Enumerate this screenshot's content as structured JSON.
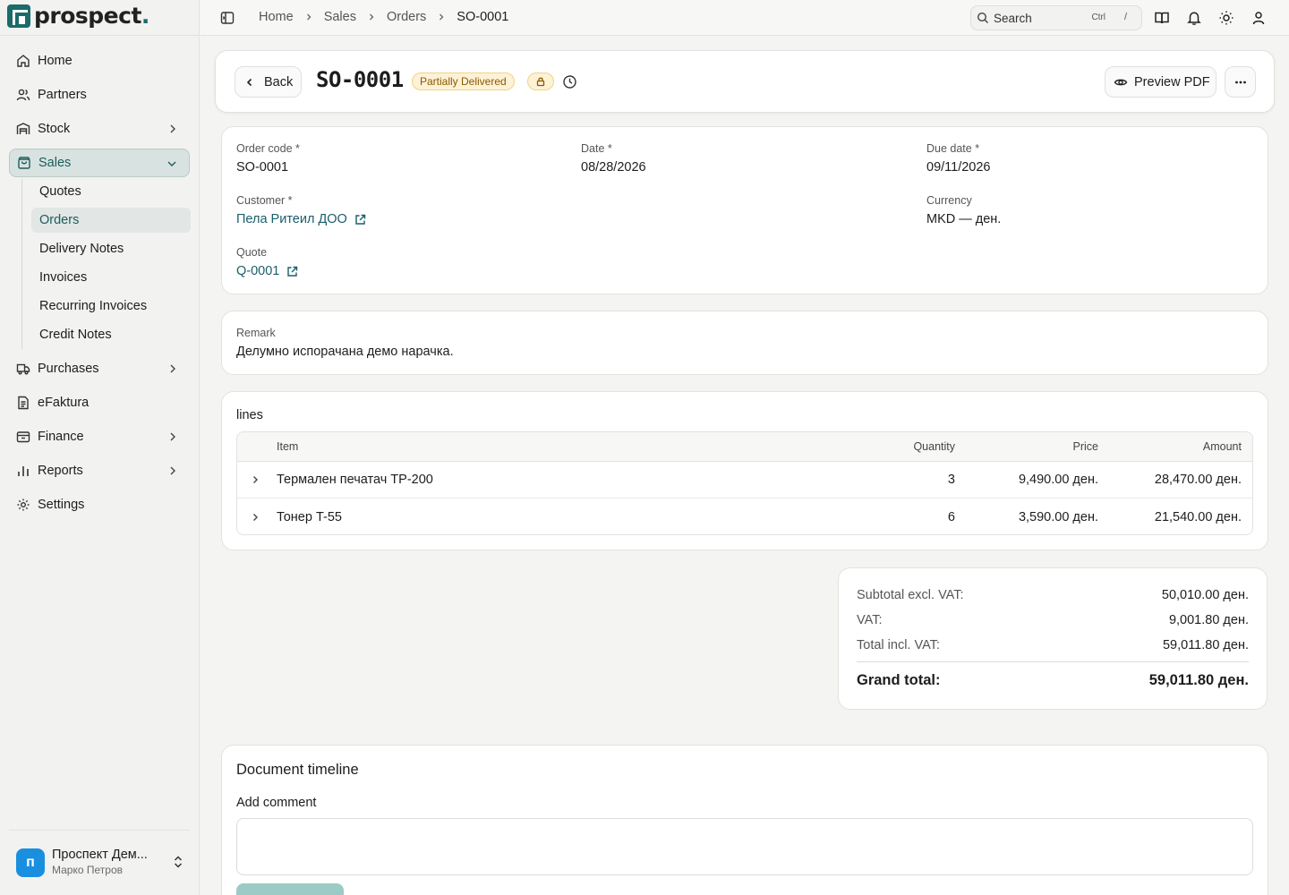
{
  "app": {
    "brand_name": "prospect",
    "brand_dot": "."
  },
  "sidebar": {
    "items": [
      {
        "label": "Home",
        "icon": "home-icon"
      },
      {
        "label": "Partners",
        "icon": "users-icon"
      },
      {
        "label": "Stock",
        "icon": "warehouse-icon"
      },
      {
        "label": "Sales",
        "icon": "shopping-bag-icon"
      },
      {
        "label": "Purchases",
        "icon": "truck-icon"
      },
      {
        "label": "eFaktura",
        "icon": "file-text-icon"
      },
      {
        "label": "Finance",
        "icon": "wallet-icon"
      },
      {
        "label": "Reports",
        "icon": "bar-chart-icon"
      },
      {
        "label": "Settings",
        "icon": "gear-icon"
      }
    ],
    "sales_subitems": [
      {
        "label": "Quotes"
      },
      {
        "label": "Orders"
      },
      {
        "label": "Delivery Notes"
      },
      {
        "label": "Invoices"
      },
      {
        "label": "Recurring Invoices"
      },
      {
        "label": "Credit Notes"
      }
    ],
    "account": {
      "initial": "п",
      "name": "Проспект Дем...",
      "user": "Марко Петров"
    }
  },
  "topbar": {
    "breadcrumb": [
      "Home",
      "Sales",
      "Orders",
      "SO-0001"
    ],
    "search": {
      "placeholder": "Search",
      "shortcut_mod": "Ctrl",
      "shortcut_key": "/"
    }
  },
  "document": {
    "back_label": "Back",
    "title": "SO-0001",
    "status": "Partially Delivered",
    "preview_label": "Preview PDF",
    "more_label": "···"
  },
  "details": {
    "order_code_label": "Order code *",
    "order_code": "SO-0001",
    "date_label": "Date *",
    "date": "08/28/2026",
    "due_date_label": "Due date *",
    "due_date": "09/11/2026",
    "customer_label": "Customer *",
    "customer": "Пела Ритеил ДОО",
    "currency_label": "Currency",
    "currency": "MKD — ден.",
    "quote_label": "Quote",
    "quote": "Q-0001"
  },
  "remark": {
    "label": "Remark",
    "text": "Делумно испорачана демо нарачка."
  },
  "lines": {
    "title": "lines",
    "columns": {
      "item": "Item",
      "quantity": "Quantity",
      "price": "Price",
      "amount": "Amount"
    },
    "rows": [
      {
        "item": "Термален печатач TP-200",
        "quantity": "3",
        "price": "9,490.00 ден.",
        "amount": "28,470.00 ден."
      },
      {
        "item": "Тонер T-55",
        "quantity": "6",
        "price": "3,590.00 ден.",
        "amount": "21,540.00 ден."
      }
    ]
  },
  "totals": {
    "subtotal_label": "Subtotal excl. VAT:",
    "subtotal": "50,010.00 ден.",
    "vat_label": "VAT:",
    "vat": "9,001.80 ден.",
    "total_label": "Total incl. VAT:",
    "total": "59,011.80 ден.",
    "grand_label": "Grand total:",
    "grand": "59,011.80 ден."
  },
  "timeline": {
    "title": "Document timeline",
    "comment_label": "Add comment",
    "comment_value": ""
  },
  "colors": {
    "accent": "#1a6b6a",
    "link": "#1a5e6a",
    "status_bg": "#fdf1d6",
    "status_text": "#8a5a00",
    "avatar": "#1a8fe0"
  }
}
